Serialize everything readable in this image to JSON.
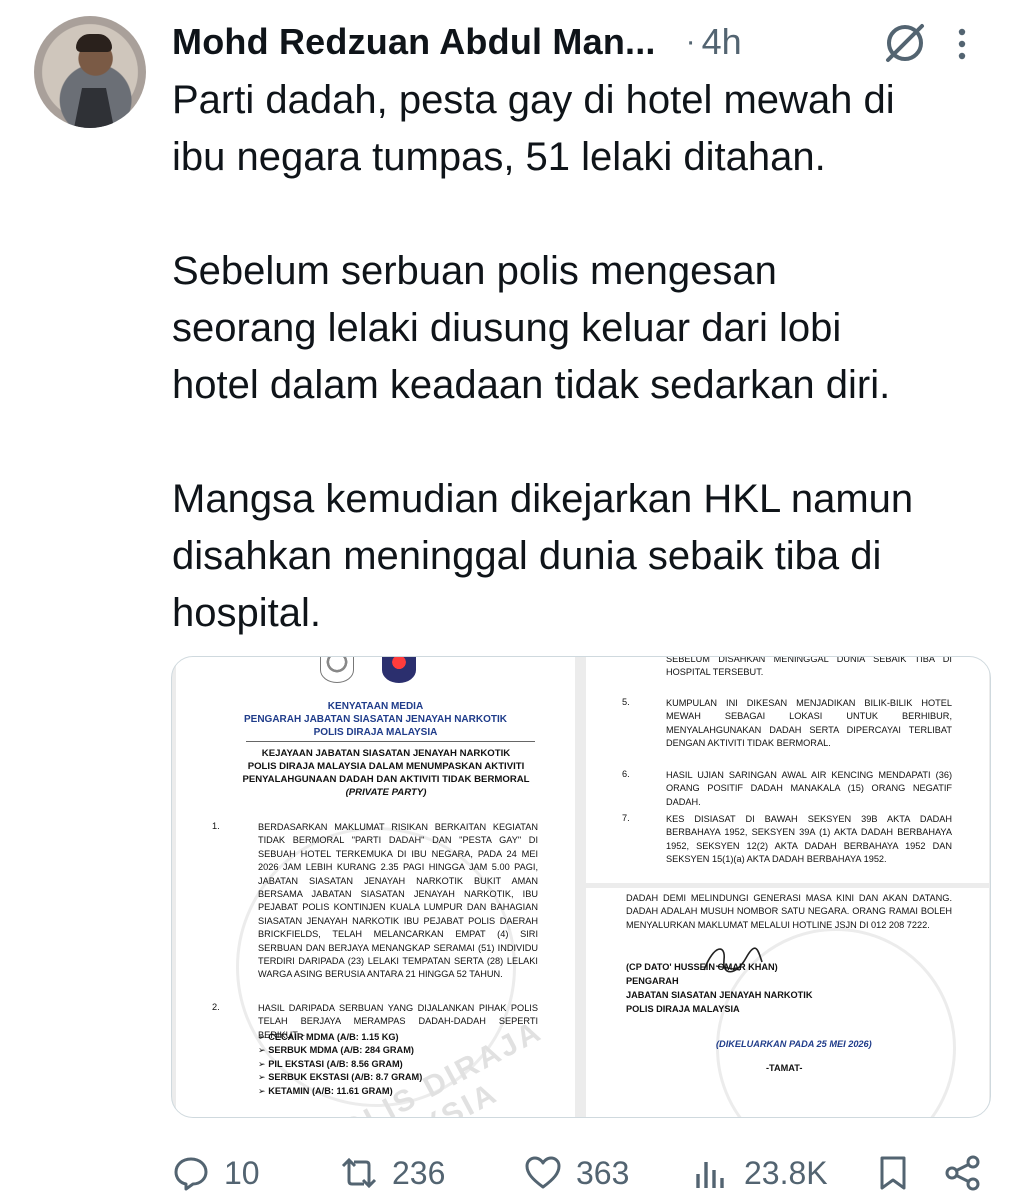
{
  "post": {
    "author": "Mohd Redzuan Abdul Man...",
    "separator": "·",
    "time": "4h",
    "text_lines": [
      "Parti dadah, pesta gay di hotel mewah di",
      "ibu negara tumpas, 51 lelaki ditahan.",
      "",
      "Sebelum serbuan polis mengesan",
      "seorang lelaki diusung keluar dari lobi",
      "hotel dalam keadaan tidak sedarkan diri.",
      "",
      "Mangsa kemudian dikejarkan HKL namun",
      "disahkan meninggal dunia sebaik tiba di",
      "hospital."
    ]
  },
  "document": {
    "left": {
      "head1": "KENYATAAN MEDIA",
      "head2": "PENGARAH JABATAN SIASATAN JENAYAH NARKOTIK",
      "head3": "POLIS DIRAJA MALAYSIA",
      "title1": "KEJAYAAN JABATAN SIASATAN JENAYAH NARKOTIK",
      "title2": "POLIS DIRAJA MALAYSIA DALAM MENUMPASKAN AKTIVITI",
      "title3": "PENYALAHGUNAAN DADAH DAN AKTIVITI TIDAK BERMORAL",
      "title4": "(PRIVATE PARTY)",
      "p1_num": "1.",
      "p1": "BERDASARKAN MAKLUMAT RISIKAN BERKAITAN KEGIATAN TIDAK BERMORAL \"PARTI DADAH\" DAN \"PESTA GAY\" DI SEBUAH HOTEL TERKEMUKA DI IBU NEGARA, PADA 24 MEI 2026 JAM LEBIH KURANG 2.35 PAGI HINGGA JAM 5.00 PAGI, JABATAN SIASATAN JENAYAH NARKOTIK BUKIT AMAN BERSAMA JABATAN SIASATAN JENAYAH NARKOTIK, IBU PEJABAT POLIS KONTINJEN KUALA LUMPUR DAN BAHAGIAN SIASATAN JENAYAH NARKOTIK IBU PEJABAT POLIS DAERAH BRICKFIELDS, TELAH MELANCARKAN EMPAT (4) SIRI SERBUAN DAN BERJAYA MENANGKAP SERAMAI (51) INDIVIDU TERDIRI DARIPADA (23) LELAKI TEMPATAN SERTA (28) LELAKI WARGA ASING BERUSIA ANTARA 21 HINGGA 52 TAHUN.",
      "p2_num": "2.",
      "p2": "HASIL DARIPADA SERBUAN YANG DIJALANKAN PIHAK POLIS TELAH BERJAYA MERAMPAS DADAH-DADAH SEPERTI BERIKUT: -",
      "items": [
        "CECAIR MDMA (A/B: 1.15 KG)",
        "SERBUK MDMA (A/B: 284 GRAM)",
        "PIL EKSTASI (A/B: 8.56 GRAM)",
        "SERBUK EKSTASI (A/B: 8.7 GRAM)",
        "KETAMIN (A/B: 11.61 GRAM)"
      ],
      "watermark": "POLIS DIRAJA MALAYSIA"
    },
    "right_top": {
      "cont": "SEBELUM DISAHKAN MENINGGAL DUNIA SEBAIK TIBA DI HOSPITAL TERSEBUT.",
      "p5_num": "5.",
      "p5": "KUMPULAN INI DIKESAN MENJADIKAN BILIK-BILIK HOTEL MEWAH SEBAGAI LOKASI UNTUK BERHIBUR, MENYALAHGUNAKAN DADAH SERTA DIPERCAYAI TERLIBAT DENGAN AKTIVITI TIDAK BERMORAL.",
      "p6_num": "6.",
      "p6": "HASIL UJIAN SARINGAN AWAL AIR KENCING MENDAPATI (36) ORANG POSITIF DADAH MANAKALA (15) ORANG NEGATIF DADAH.",
      "p7_num": "7.",
      "p7": "KES DISIASAT DI BAWAH SEKSYEN 39B AKTA DADAH BERBAHAYA 1952, SEKSYEN 39A (1) AKTA DADAH BERBAHAYA 1952, SEKSYEN 12(2) AKTA DADAH BERBAHAYA 1952 DAN SEKSYEN 15(1)(a) AKTA DADAH BERBAHAYA 1952."
    },
    "right_bottom": {
      "cont": "DADAH DEMI MELINDUNGI GENERASI MASA KINI DAN AKAN DATANG. DADAH ADALAH MUSUH NOMBOR SATU NEGARA. ORANG RAMAI BOLEH MENYALURKAN MAKLUMAT MELALUI HOTLINE JSJN DI 012 208 7222.",
      "signer": "(CP DATO' HUSSEIN OMAR KHAN)",
      "role1": "PENGARAH",
      "role2": "JABATAN SIASATAN JENAYAH NARKOTIK",
      "role3": "POLIS DIRAJA MALAYSIA",
      "issued": "(DIKELUARKAN PADA 25 MEI 2026)",
      "end": "-TAMAT-"
    }
  },
  "actions": {
    "replies": "10",
    "reposts": "236",
    "likes": "363",
    "views": "23.8K"
  },
  "icons": [
    "grok-icon",
    "more-icon",
    "reply-icon",
    "repost-icon",
    "like-icon",
    "views-icon",
    "bookmark-icon",
    "share-icon"
  ],
  "colors": {
    "text": "#0f1419",
    "muted": "#536471",
    "border": "#cfd9de",
    "doc_blue": "#1f3c8a"
  }
}
